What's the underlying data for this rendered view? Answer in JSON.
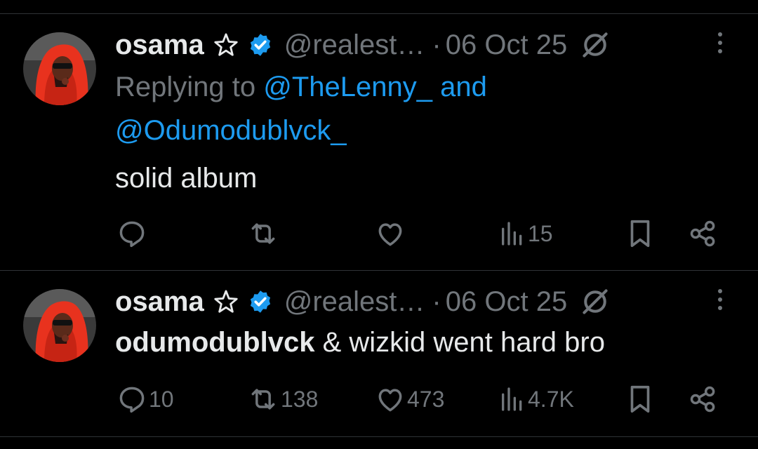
{
  "colors": {
    "background": "#000000",
    "text": "#e7e9ea",
    "muted": "#71767b",
    "link": "#1d9bf0",
    "verified": "#1d9bf0"
  },
  "tweets": [
    {
      "avatar": "user-avatar-red-hoodie",
      "author_name": "osama",
      "author_icon": "star-icon",
      "verified_icon": "verified-badge-icon",
      "handle": "@realest…",
      "separator": "·",
      "date": "06 Oct 25",
      "grok_icon": "grok-icon",
      "more_icon": "more-options-icon",
      "reply_prefix": "Replying to",
      "reply_to_1": "@TheLenny_",
      "reply_and": "and",
      "reply_to_2": "@Odumodublvck_",
      "body": "solid album",
      "actions": {
        "reply_count": "",
        "retweet_count": "",
        "like_count": "",
        "views_count": "15"
      }
    },
    {
      "avatar": "user-avatar-red-hoodie",
      "author_name": "osama",
      "author_icon": "star-icon",
      "verified_icon": "verified-badge-icon",
      "handle": "@realest…",
      "separator": "·",
      "date": "06 Oct 25",
      "grok_icon": "grok-icon",
      "more_icon": "more-options-icon",
      "body_bold": "odumodublvck",
      "body_rest": " & wizkid went hard bro",
      "actions": {
        "reply_count": "10",
        "retweet_count": "138",
        "like_count": "473",
        "views_count": "4.7K"
      }
    }
  ]
}
